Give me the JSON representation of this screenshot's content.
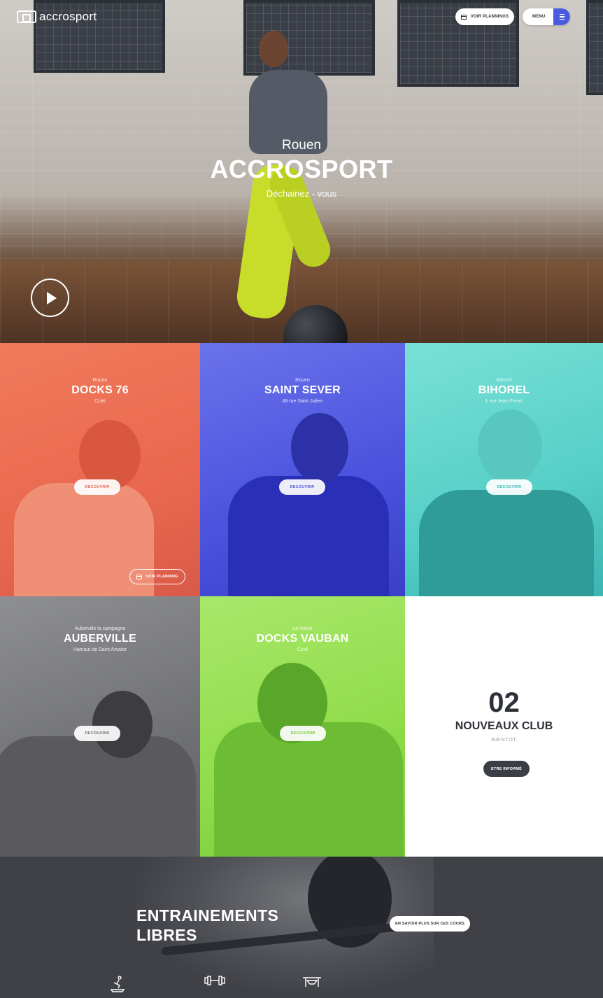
{
  "header": {
    "logo_text": "accrosport",
    "plannings_label": "VOIR PLANNINGS",
    "menu_label": "MENU"
  },
  "hero": {
    "city": "Rouen",
    "title": "ACCROSPORT",
    "subtitle": "Déchainez - vous"
  },
  "clubs": [
    {
      "city": "Rouen",
      "name": "DOCKS 76",
      "address": "Cciel",
      "discover_label": "DECOUVRIR",
      "planning_label": "VOIR PLANNING",
      "color": "#e9684f"
    },
    {
      "city": "Rouen",
      "name": "SAINT SEVER",
      "address": "49 rue Saint Julien",
      "discover_label": "DECOUVRIR",
      "color": "#4a52de"
    },
    {
      "city": "Bihorel",
      "name": "BIHOREL",
      "address": "1 rue Jean Freret",
      "discover_label": "DECOUVRIR",
      "color": "#55cfc7"
    },
    {
      "city": "Auberville la campagne",
      "name": "AUBERVILLE",
      "address": "Hamaut de Saint Amator",
      "discover_label": "DECOUVRIR",
      "color": "#707175"
    },
    {
      "city": "Le Havre",
      "name": "DOCKS VAUBAN",
      "address": "Cciel",
      "discover_label": "DECOUVRIR",
      "color": "#8fdc4a"
    }
  ],
  "new_clubs": {
    "count": "02",
    "title": "NOUVEAUX CLUB",
    "soon": "BIENTOT",
    "button_label": "ETRE INFORMÉ"
  },
  "training": {
    "title_line1": "ENTRAINEMENTS",
    "title_line2": "LIBRES",
    "button_label": "EN SAVOIR PLUS SUR CES COURS",
    "icons": [
      "treadmill-icon",
      "dumbbell-icon",
      "bench-icon"
    ]
  }
}
